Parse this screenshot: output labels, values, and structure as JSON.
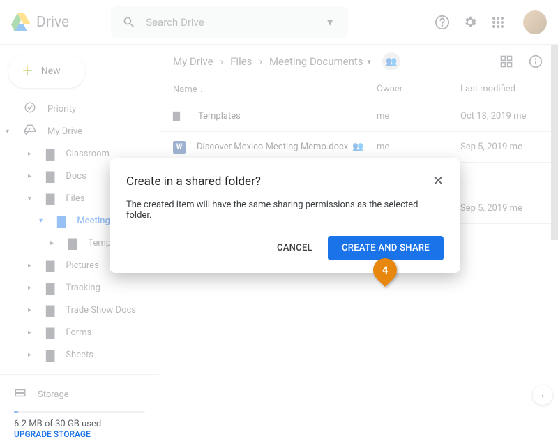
{
  "header": {
    "app": "Drive",
    "search_placeholder": "Search Drive"
  },
  "sidebar": {
    "new_label": "New",
    "priority": "Priority",
    "mydrive": "My Drive",
    "tree": [
      {
        "label": "Classroom"
      },
      {
        "label": "Docs"
      },
      {
        "label": "Files"
      },
      {
        "label": "Meeting Documents",
        "active": true
      },
      {
        "label": "Templates"
      },
      {
        "label": "Pictures"
      },
      {
        "label": "Tracking"
      },
      {
        "label": "Trade Show Docs"
      },
      {
        "label": "Forms"
      },
      {
        "label": "Sheets"
      }
    ],
    "storage": {
      "title": "Storage",
      "used": "6.2 MB of 30 GB used",
      "upgrade": "UPGRADE STORAGE"
    }
  },
  "breadcrumb": {
    "a": "My Drive",
    "b": "Files",
    "c": "Meeting Documents"
  },
  "columns": {
    "name": "Name",
    "owner": "Owner",
    "modified": "Last modified"
  },
  "rows": [
    {
      "kind": "folder",
      "name": "Templates",
      "owner": "me",
      "modified": "Oct 18, 2019 me"
    },
    {
      "kind": "docx",
      "name": "Discover Mexico Meeting Memo.docx",
      "shared": true,
      "owner": "me",
      "modified": "Sep 5, 2019 me"
    },
    {
      "kind": "docx",
      "name": "",
      "owner": "",
      "modified": ""
    },
    {
      "kind": "docx",
      "name": "",
      "owner": "",
      "modified": "Sep 5, 2019 me"
    }
  ],
  "dialog": {
    "title": "Create in a shared folder?",
    "body": "The created item will have the same sharing permissions as the selected folder.",
    "cancel": "CANCEL",
    "confirm": "CREATE AND SHARE"
  },
  "callout": "4"
}
